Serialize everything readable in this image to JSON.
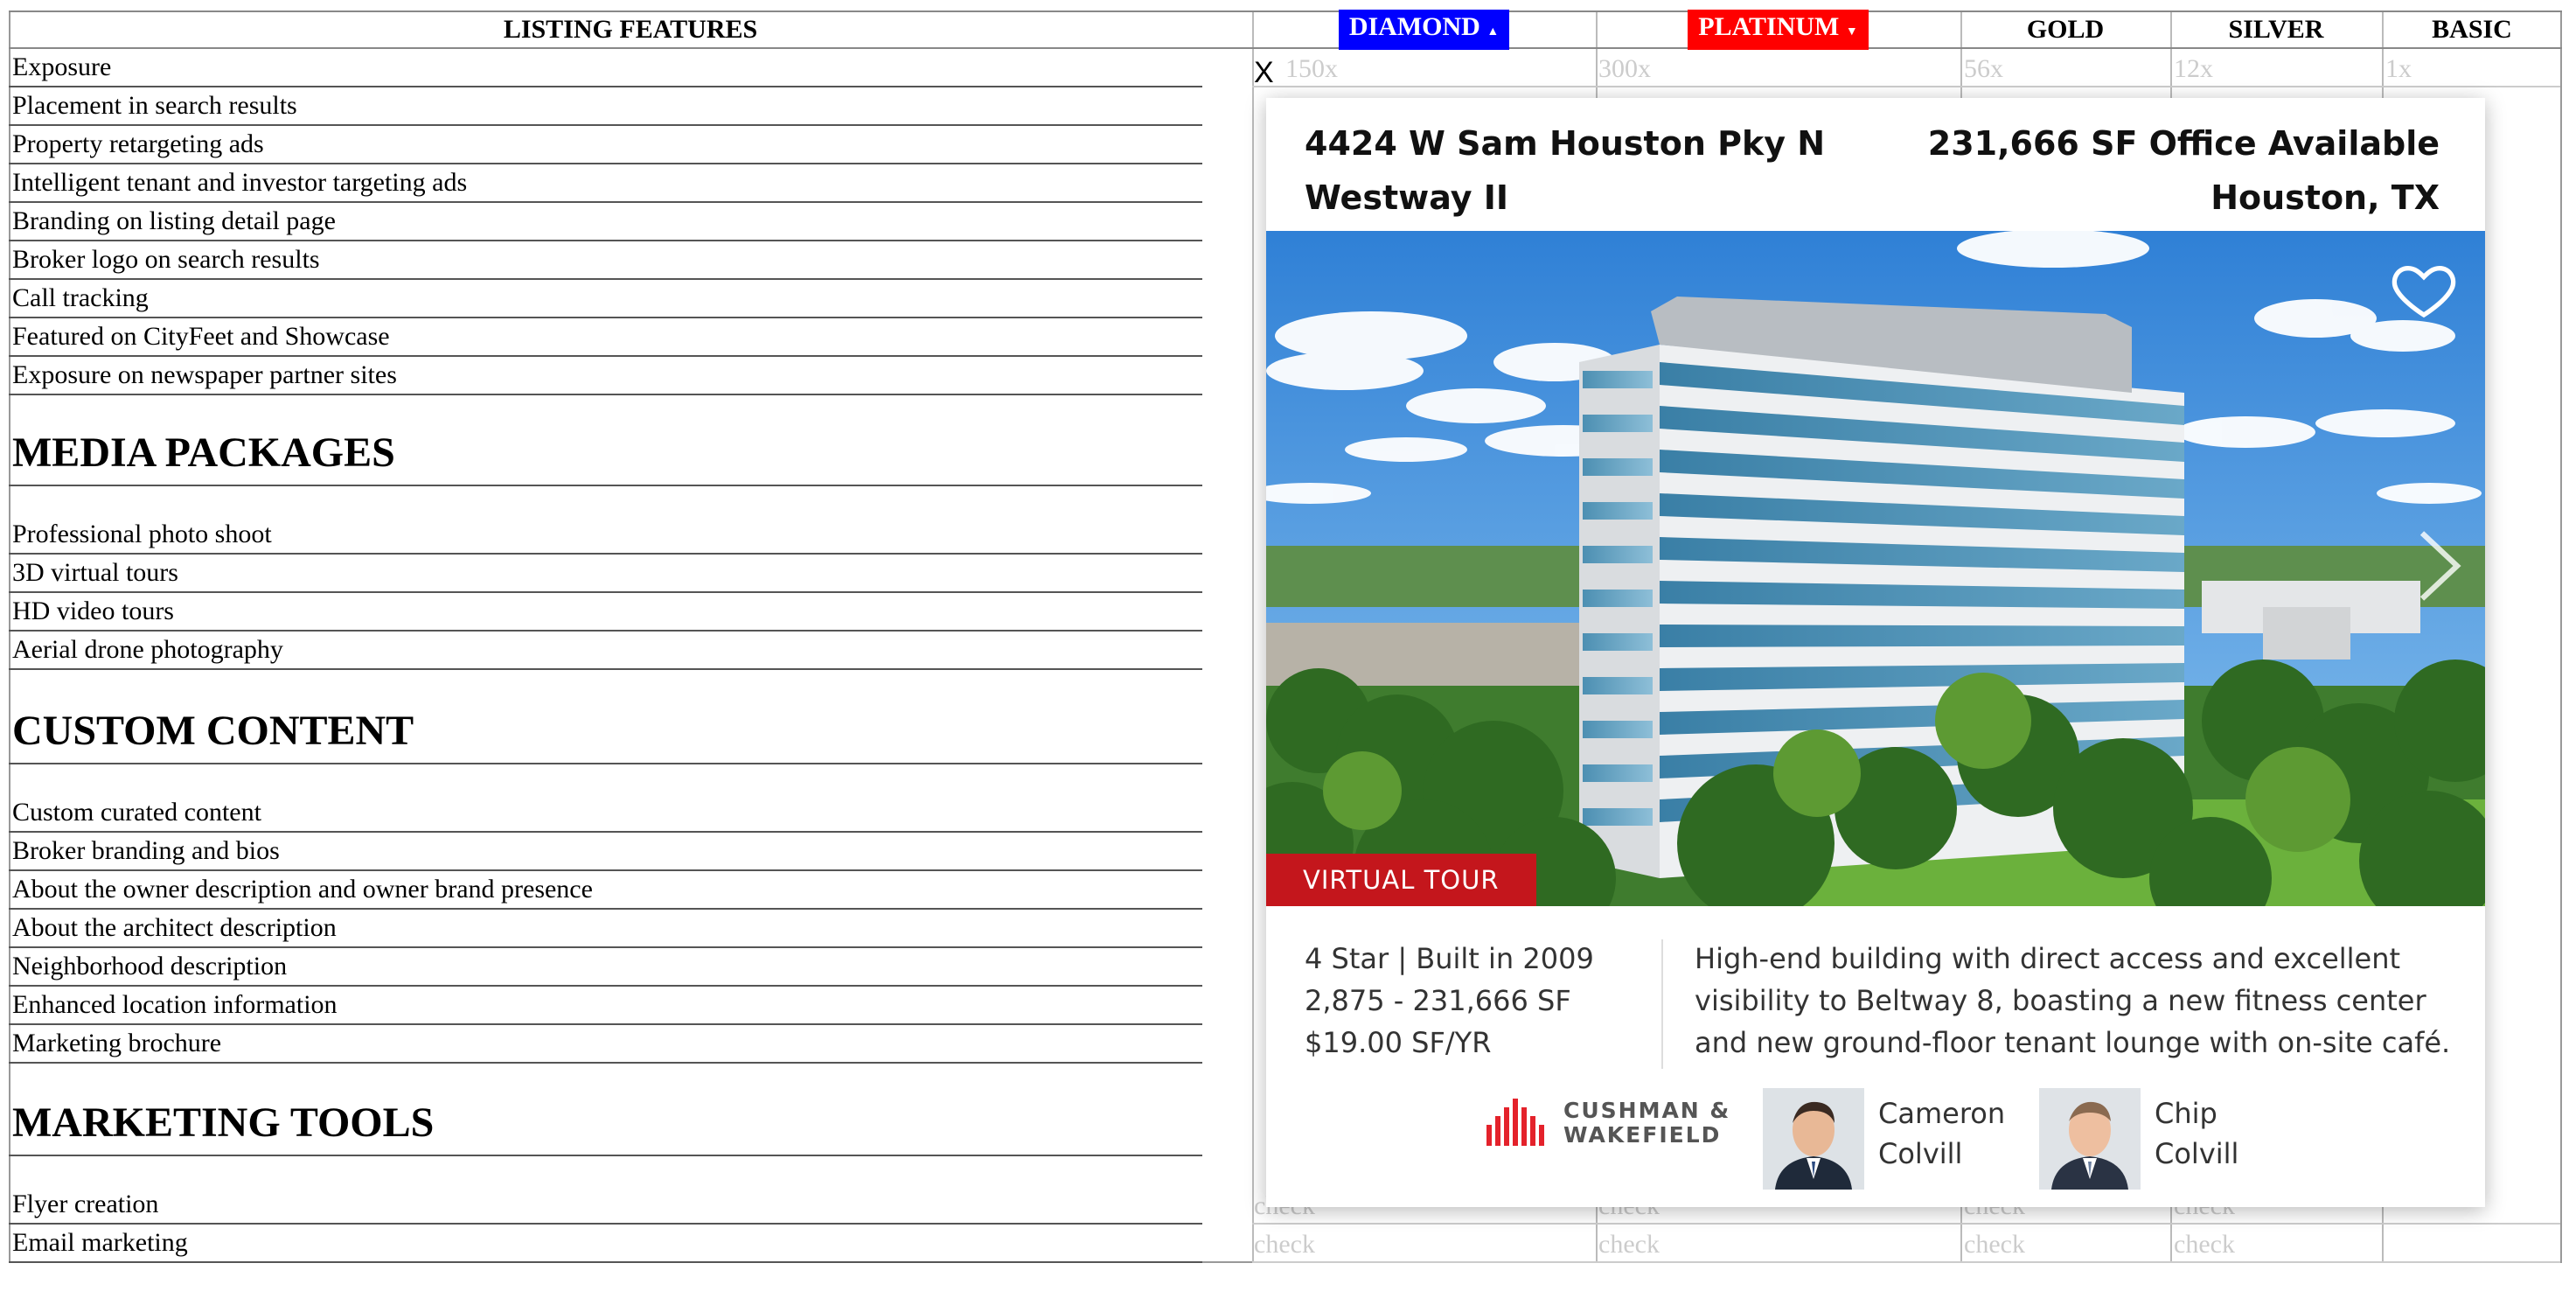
{
  "table": {
    "features_header": "LISTING FEATURES",
    "tiers": [
      {
        "name": "DIAMOND",
        "color": "#0000ff",
        "arrow": "▲"
      },
      {
        "name": "PLATINUM",
        "color": "#ff0000",
        "arrow": "▼"
      },
      {
        "name": "GOLD"
      },
      {
        "name": "SILVER"
      },
      {
        "name": "BASIC"
      }
    ],
    "close_symbol": "X",
    "exposure_values": [
      "150x",
      "300x",
      "56x",
      "12x",
      "1x"
    ],
    "check_label": "check",
    "listing_features": [
      "Exposure",
      "Placement in search results",
      "Property retargeting ads",
      "Intelligent tenant and investor targeting ads",
      "Branding on listing detail page",
      "Broker logo on search results",
      "Call tracking",
      "Featured on CityFeet and Showcase",
      "Exposure on newspaper partner sites"
    ],
    "media_header": "MEDIA PACKAGES",
    "media_features": [
      "Professional photo shoot",
      "3D virtual tours",
      "HD video tours",
      "Aerial drone photography"
    ],
    "custom_header": "CUSTOM CONTENT",
    "custom_features": [
      "Custom curated content",
      "Broker branding and bios",
      "About the owner description and owner brand presence",
      "About the architect description",
      "Neighborhood description",
      "Enhanced location information",
      "Marketing brochure"
    ],
    "marketing_header": "MARKETING TOOLS",
    "marketing_features": [
      "Flyer creation",
      "Email marketing"
    ]
  },
  "listing": {
    "address_line1": "4424 W Sam Houston Pky N",
    "building_name": "Westway II",
    "availability": "231,666 SF Office Available",
    "city_state": "Houston, TX",
    "badge": "VIRTUAL TOUR",
    "specs": [
      "4 Star | Built in 2009",
      "2,875 - 231,666 SF",
      "$19.00 SF/YR"
    ],
    "description": "High-end building with direct access and excellent visibility to Beltway 8, boasting a new fitness center and new ground-floor tenant lounge with on-site café.",
    "brokerage_logo": [
      "CUSHMAN &",
      "WAKEFIELD"
    ],
    "agents": [
      {
        "first": "Cameron",
        "last": "Colvill"
      },
      {
        "first": "Chip",
        "last": "Colvill"
      }
    ],
    "icons": [
      "heart-icon",
      "chevron-right-icon"
    ],
    "accent_color": "#c4161c"
  }
}
